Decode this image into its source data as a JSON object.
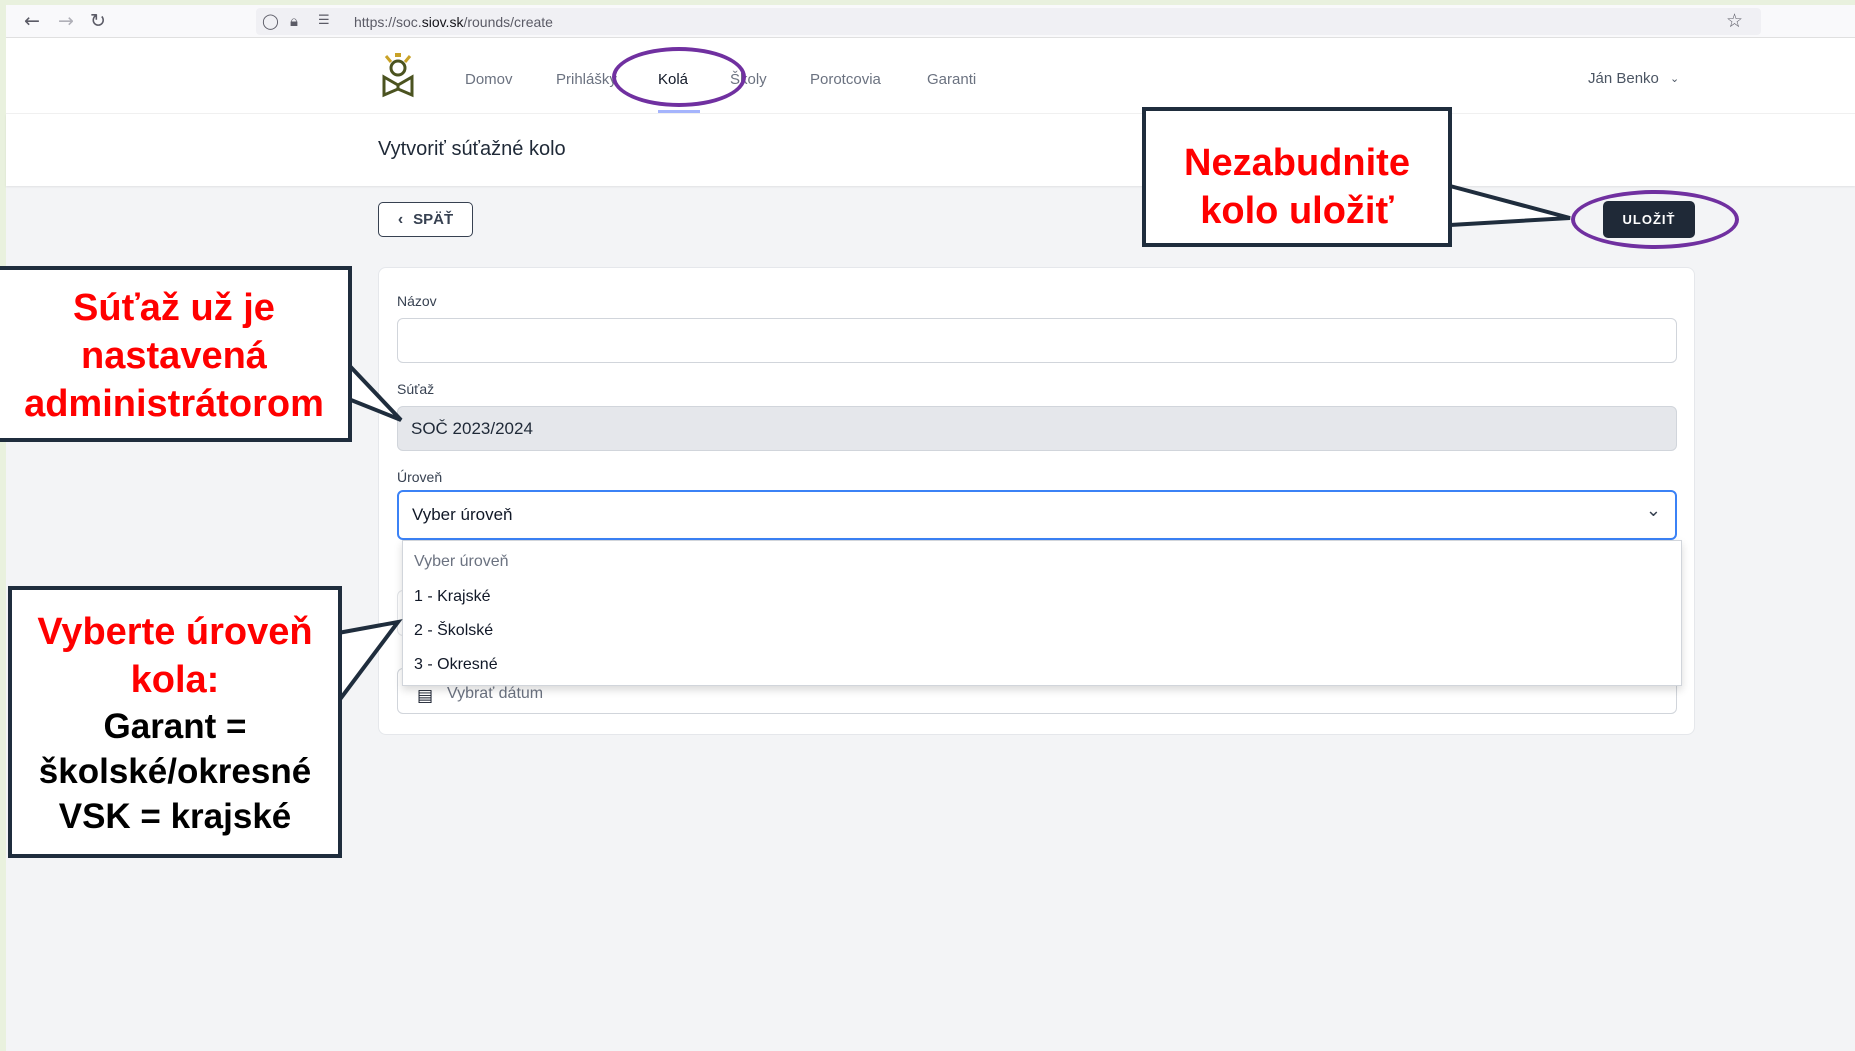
{
  "browser": {
    "url_prefix": "https://soc.",
    "url_domain": "siov.sk",
    "url_path": "/rounds/create"
  },
  "nav": {
    "items": [
      "Domov",
      "Prihlášky",
      "Kolá",
      "Školy",
      "Porotcovia",
      "Garanti"
    ],
    "active": "Kolá",
    "user": "Ján Benko"
  },
  "page": {
    "title": "Vytvoriť súťažné kolo",
    "back_label": "SPÄŤ",
    "save_label": "ULOŽIŤ"
  },
  "form": {
    "name_label": "Názov",
    "name_value": "",
    "contest_label": "Súťaž",
    "contest_value": "SOČ 2023/2024",
    "level_label": "Úroveň",
    "level_value": "Vyber úroveň",
    "level_options": [
      "Vyber úroveň",
      "1 - Krajské",
      "2 - Školské",
      "3 - Okresné"
    ],
    "date_placeholder": "Vybrať dátum"
  },
  "annotations": {
    "save": [
      "Nezabudnite",
      "kolo uložiť"
    ],
    "contest": [
      "Súťaž už je",
      "nastavená",
      "administrátorom"
    ],
    "level_title": [
      "Vyberte úroveň",
      "kola:"
    ],
    "level_body": [
      "Garant =",
      "školské/okresné",
      "VSK = krajské"
    ]
  },
  "colors": {
    "annotation_text": "#ff0000",
    "annotation_oval": "#7030a0",
    "select_focus": "#3b82f6",
    "save_button": "#1f2937"
  }
}
